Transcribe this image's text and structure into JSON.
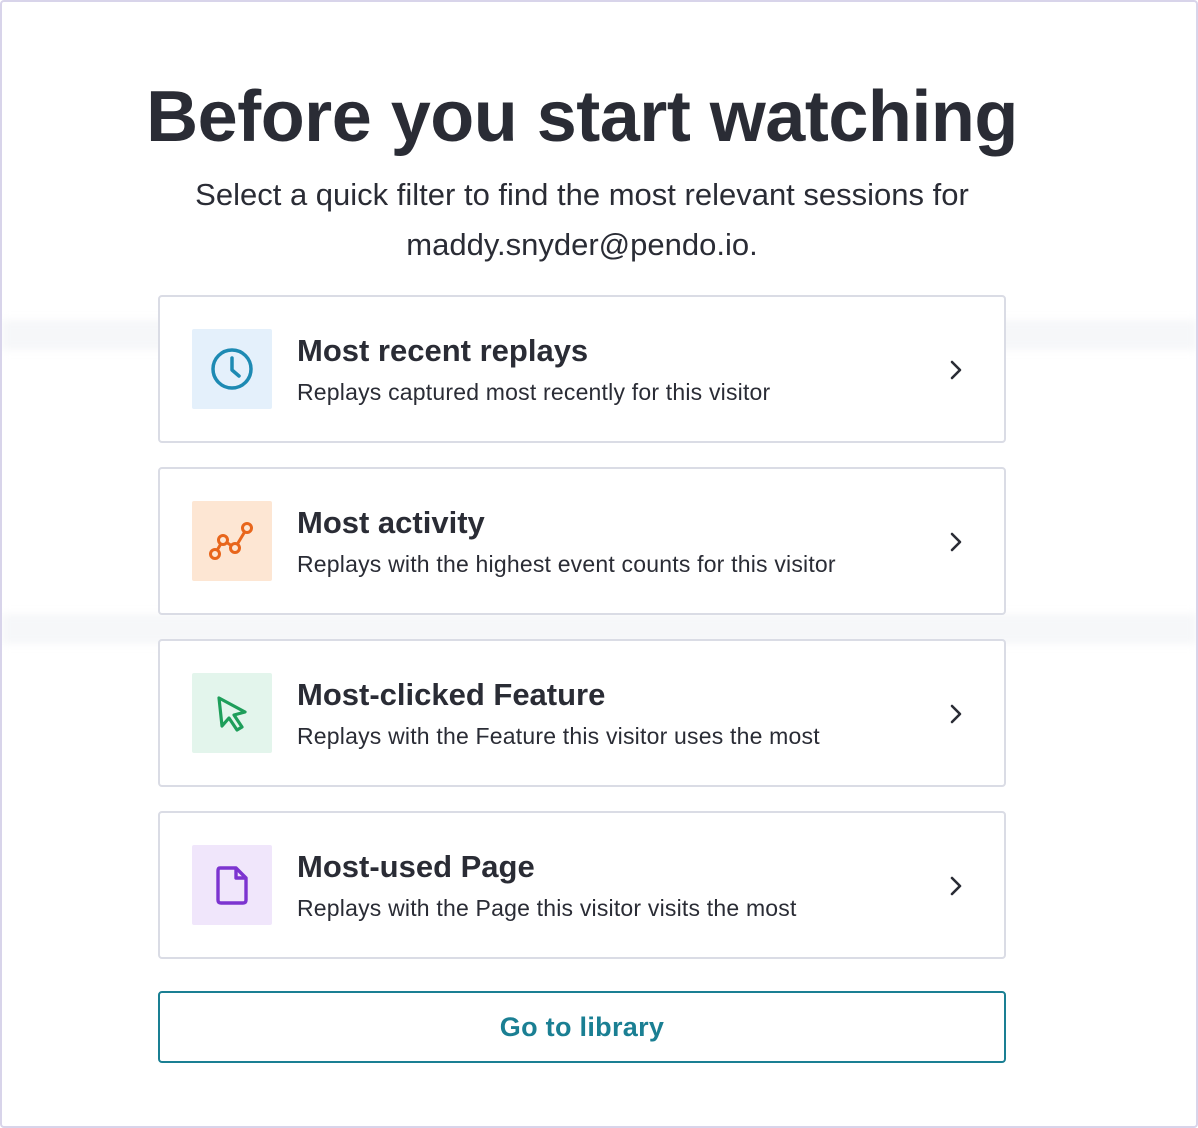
{
  "modal": {
    "title": "Before you start watching",
    "subtitle_line1": "Select a quick filter to find the most relevant sessions for",
    "subtitle_line2": "maddy.snyder@pendo.io."
  },
  "options": [
    {
      "title": "Most recent replays",
      "description": "Replays captured most recently for this visitor",
      "icon": "clock-icon",
      "icon_bg": "#e4f0fb",
      "icon_color": "#1d8ab3"
    },
    {
      "title": "Most activity",
      "description": "Replays with the highest event counts for this visitor",
      "icon": "activity-graph-icon",
      "icon_bg": "#fde6d3",
      "icon_color": "#e8661c"
    },
    {
      "title": "Most-clicked Feature",
      "description": "Replays with the Feature this visitor uses the most",
      "icon": "cursor-pointer-icon",
      "icon_bg": "#e3f5ec",
      "icon_color": "#1e9e5a"
    },
    {
      "title": "Most-used Page",
      "description": "Replays with the Page this visitor visits the most",
      "icon": "page-document-icon",
      "icon_bg": "#f0e6fb",
      "icon_color": "#7c34d0"
    }
  ],
  "footer": {
    "library_button_label": "Go to library"
  },
  "colors": {
    "accent": "#1a7f93",
    "text": "#2a2c35",
    "border": "#dadce5"
  }
}
